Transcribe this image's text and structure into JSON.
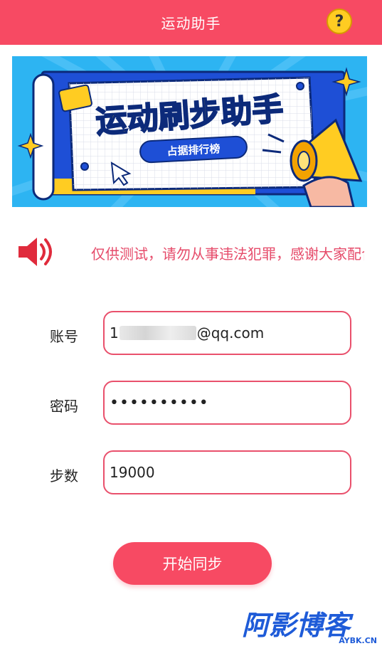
{
  "header": {
    "title": "运动助手",
    "help_icon": "question-circle-icon",
    "help_symbol": "?"
  },
  "banner": {
    "title": "运动刷步助手",
    "badge": "占据排行榜"
  },
  "notice": {
    "icon": "speaker-icon",
    "text": "仅供测试，请勿从事违法犯罪，感谢大家配合"
  },
  "form": {
    "account": {
      "label": "账号",
      "value_prefix": "1",
      "value_suffix": "@qq.com"
    },
    "password": {
      "label": "密码",
      "value": "••••••••••"
    },
    "steps": {
      "label": "步数",
      "value": "19000"
    }
  },
  "actions": {
    "sync_label": "开始同步"
  },
  "watermark": {
    "text": "阿影博客",
    "subtext": "AYBK.CN"
  },
  "colors": {
    "primary": "#f74a63",
    "notice_text": "#e64b6a",
    "input_border": "#e9506c"
  }
}
